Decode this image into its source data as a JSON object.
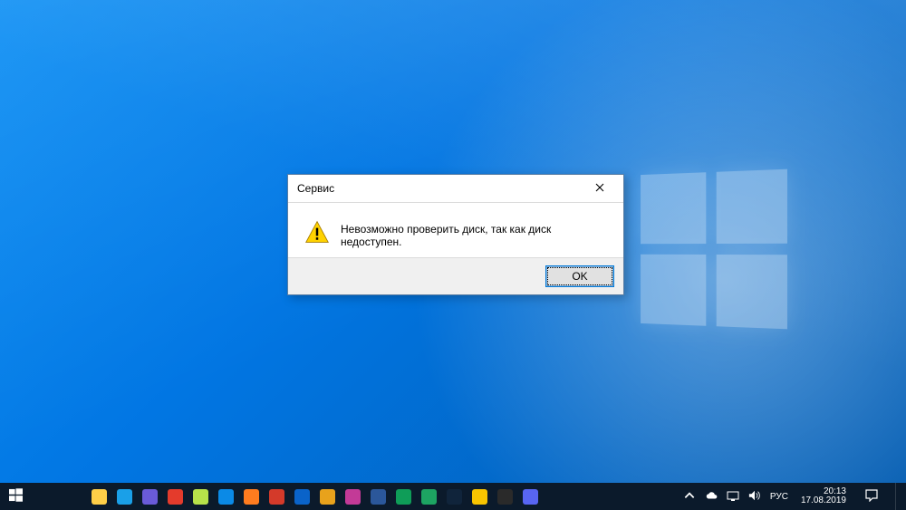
{
  "dialog": {
    "title": "Сервис",
    "message": "Невозможно проверить диск, так как диск недоступен.",
    "ok_label": "OK"
  },
  "taskbar": {
    "apps": [
      {
        "name": "explorer",
        "color": "#ffcf48"
      },
      {
        "name": "app1",
        "color": "#1aa0e8"
      },
      {
        "name": "app2",
        "color": "#6a5bd8"
      },
      {
        "name": "opera",
        "color": "#e43b2c"
      },
      {
        "name": "npp",
        "color": "#b7e24a"
      },
      {
        "name": "app3",
        "color": "#0b8ae6"
      },
      {
        "name": "firefox",
        "color": "#ff7c1f"
      },
      {
        "name": "app4",
        "color": "#d43a2a"
      },
      {
        "name": "app5",
        "color": "#0a63c9"
      },
      {
        "name": "ccleaner",
        "color": "#e8a21c"
      },
      {
        "name": "app6",
        "color": "#c33a97"
      },
      {
        "name": "word",
        "color": "#2b579a"
      },
      {
        "name": "app7",
        "color": "#0f9d58"
      },
      {
        "name": "chrome",
        "color": "#1da462"
      },
      {
        "name": "steam",
        "color": "#10243b"
      },
      {
        "name": "potplayer",
        "color": "#f8c400"
      },
      {
        "name": "obs",
        "color": "#2a2a2a"
      },
      {
        "name": "discord",
        "color": "#5865f2"
      }
    ]
  },
  "systray": {
    "language": "РУС",
    "time": "20:13",
    "date": "17.08.2019"
  }
}
